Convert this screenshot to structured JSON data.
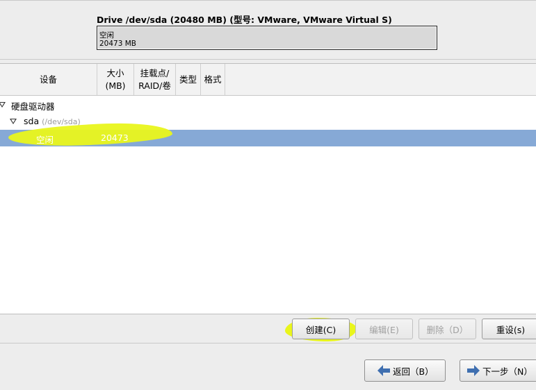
{
  "drive": {
    "title": "Drive /dev/sda (20480 MB) (型号: VMware, VMware Virtual S)",
    "free_label": "空闲",
    "free_size": "20473 MB"
  },
  "table": {
    "columns": [
      {
        "label": "设备"
      },
      {
        "label": "大小\n(MB)"
      },
      {
        "label": "挂载点/\nRAID/卷"
      },
      {
        "label": "类型"
      },
      {
        "label": "格式"
      }
    ],
    "rows": {
      "root": {
        "label": "硬盘驱动器"
      },
      "disk": {
        "label": "sda",
        "path": "(/dev/sda)"
      },
      "free": {
        "label": "空闲",
        "size": "20473"
      }
    }
  },
  "buttons": {
    "create": "创建(C)",
    "edit": "编辑(E)",
    "delete": "删除（D）",
    "reset": "重设(s)"
  },
  "nav": {
    "back": "返回（B）",
    "next": "下一步（N）"
  },
  "colors": {
    "selection": "#86a9d6",
    "highlighter": "#e9f51c",
    "arrow": "#3f6fb0"
  }
}
